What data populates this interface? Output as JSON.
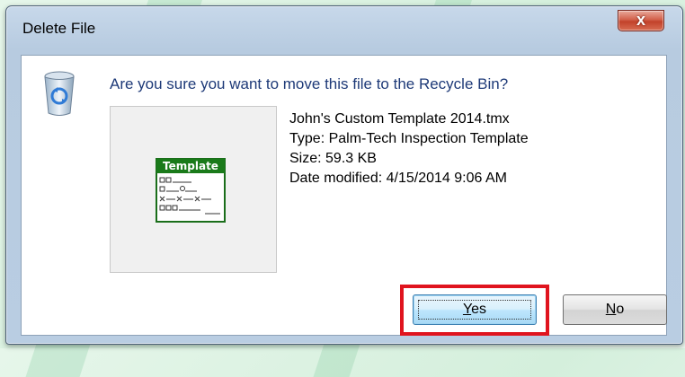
{
  "dialog": {
    "title": "Delete File",
    "close_label": "x",
    "question": "Are you sure you want to move this file to the Recycle Bin?",
    "icon": "recycle-bin-icon",
    "thumbnail": {
      "icon": "template-file-icon",
      "header_text": "Template"
    },
    "file": {
      "name": "John's Custom Template 2014.tmx",
      "type": "Type: Palm-Tech Inspection Template",
      "size": "Size: 59.3 KB",
      "date_modified": "Date modified: 4/15/2014 9:06 AM"
    },
    "buttons": {
      "yes_accel": "Y",
      "yes_rest": "es",
      "no_accel": "N",
      "no_rest": "o"
    },
    "highlight_color": "#e0141e",
    "accent_color": "#1e3a78"
  }
}
